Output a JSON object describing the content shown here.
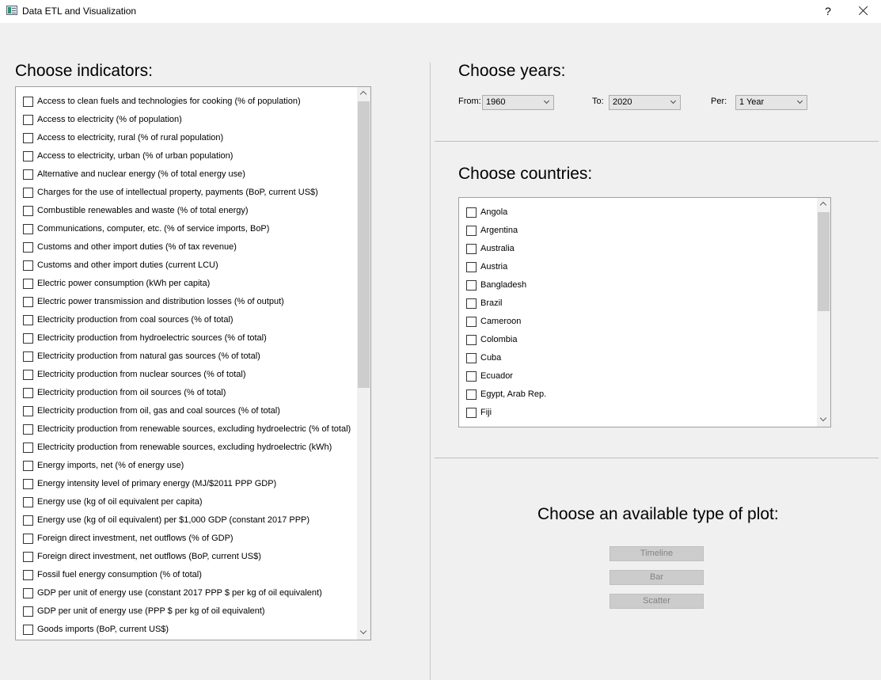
{
  "window": {
    "title": "Data ETL and Visualization",
    "help_label": "?"
  },
  "indicators": {
    "heading": "Choose indicators:",
    "items": [
      "Access to clean fuels and technologies for cooking (% of population)",
      "Access to electricity (% of population)",
      "Access to electricity, rural (% of rural population)",
      "Access to electricity, urban (% of urban population)",
      "Alternative and nuclear energy (% of total energy use)",
      "Charges for the use of intellectual property, payments (BoP, current US$)",
      "Combustible renewables and waste (% of total energy)",
      "Communications, computer, etc. (% of service imports, BoP)",
      "Customs and other import duties (% of tax revenue)",
      "Customs and other import duties (current LCU)",
      "Electric power consumption (kWh per capita)",
      "Electric power transmission and distribution losses (% of output)",
      "Electricity production from coal sources (% of total)",
      "Electricity production from hydroelectric sources (% of total)",
      "Electricity production from natural gas sources (% of total)",
      "Electricity production from nuclear sources (% of total)",
      "Electricity production from oil sources (% of total)",
      "Electricity production from oil, gas and coal sources (% of total)",
      "Electricity production from renewable sources, excluding hydroelectric (% of total)",
      "Electricity production from renewable sources, excluding hydroelectric (kWh)",
      "Energy imports, net (% of energy use)",
      "Energy intensity level of primary energy (MJ/$2011 PPP GDP)",
      "Energy use (kg of oil equivalent per capita)",
      "Energy use (kg of oil equivalent) per $1,000 GDP (constant 2017 PPP)",
      "Foreign direct investment, net outflows (% of GDP)",
      "Foreign direct investment, net outflows (BoP, current US$)",
      "Fossil fuel energy consumption (% of total)",
      "GDP per unit of energy use (constant 2017 PPP $ per kg of oil equivalent)",
      "GDP per unit of energy use (PPP $ per kg of oil equivalent)",
      "Goods imports (BoP, current US$)"
    ]
  },
  "years": {
    "heading": "Choose years:",
    "from_label": "From:",
    "from_value": "1960",
    "to_label": "To:",
    "to_value": "2020",
    "per_label": "Per:",
    "per_value": "1 Year"
  },
  "countries": {
    "heading": "Choose countries:",
    "items": [
      "Angola",
      "Argentina",
      "Australia",
      "Austria",
      "Bangladesh",
      "Brazil",
      "Cameroon",
      "Colombia",
      "Cuba",
      "Ecuador",
      "Egypt, Arab Rep.",
      "Fiji"
    ]
  },
  "plot": {
    "heading": "Choose an available type of plot:",
    "buttons": [
      "Timeline",
      "Bar",
      "Scatter"
    ]
  },
  "icons": {
    "app": "app-window-icon",
    "close": "close-icon",
    "scroll_up": "chevron-up-icon",
    "scroll_down": "chevron-down-icon",
    "dropdown": "chevron-down-icon"
  }
}
